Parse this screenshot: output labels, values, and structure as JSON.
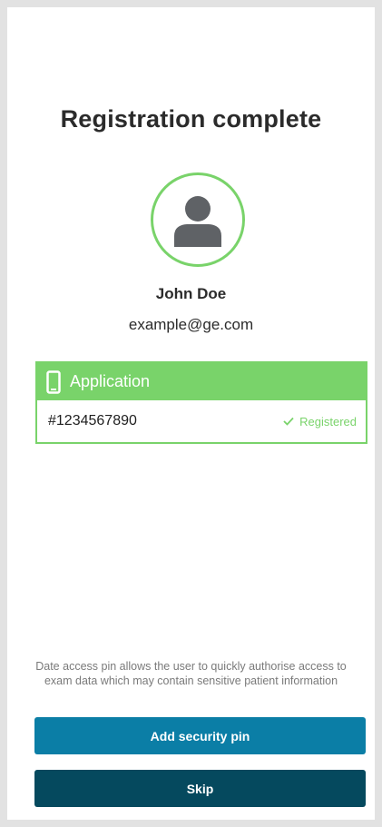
{
  "page": {
    "title": "Registration complete"
  },
  "user": {
    "avatar_icon": "user-silhouette-icon",
    "name": "John Doe",
    "email": "example@ge.com"
  },
  "application": {
    "header_icon": "mobile-phone-icon",
    "title": "Application",
    "id": "#1234567890",
    "status_icon": "check-icon",
    "status": "Registered"
  },
  "info": {
    "text": "Date access pin allows the user to quickly authorise access to exam data which may contain sensitive patient information"
  },
  "actions": {
    "primary_label": "Add security pin",
    "secondary_label": "Skip"
  },
  "colors": {
    "accent_green": "#79d36a",
    "primary_button": "#0b7ea6",
    "secondary_button": "#05495e",
    "text_dark": "#2b2b2b",
    "text_muted": "#7a7a7a"
  }
}
